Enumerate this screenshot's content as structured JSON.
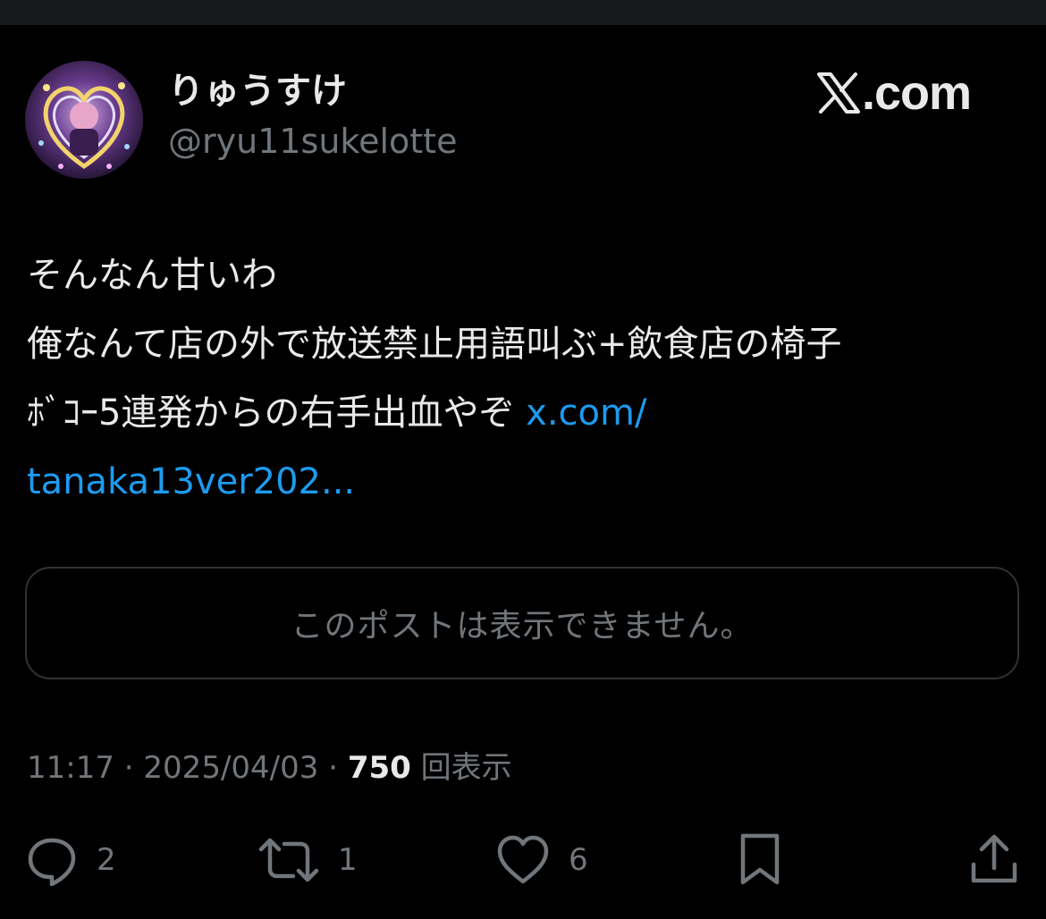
{
  "author": {
    "display_name": "りゅうすけ",
    "handle": "@ryu11sukelotte"
  },
  "brand": {
    "text": ".com",
    "logo_icon": "x-logo-icon"
  },
  "post": {
    "lines": [
      "そんなん甘いわ",
      "俺なんて店の外で放送禁止用語叫ぶ+飲食店の椅子",
      "ﾎﾞｺｰ5連発からの右手出血やぞ "
    ],
    "link_part1": "x.com/",
    "link_part2": "tanaka13ver202..."
  },
  "quoted_post": {
    "unavailable_text": "このポストは表示できません。"
  },
  "meta": {
    "time": "11:17",
    "separator": " · ",
    "date": "2025/04/03",
    "views_count": "750",
    "views_label": "回表示"
  },
  "actions": {
    "reply": {
      "icon": "reply-icon",
      "count": "2"
    },
    "repost": {
      "icon": "repost-icon",
      "count": "1"
    },
    "like": {
      "icon": "like-icon",
      "count": "6"
    },
    "bookmark": {
      "icon": "bookmark-icon"
    },
    "share": {
      "icon": "share-icon"
    }
  },
  "colors": {
    "background": "#000000",
    "text_primary": "#e7e9ea",
    "text_secondary": "#71767b",
    "link": "#1d9bf0",
    "border": "#2f3336"
  }
}
